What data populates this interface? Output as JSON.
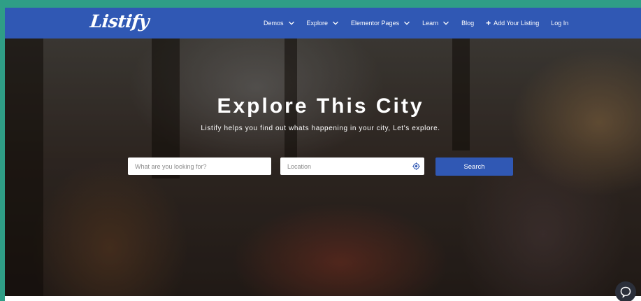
{
  "brand": {
    "logo_text": "Listify"
  },
  "nav": {
    "items": [
      {
        "label": "Demos",
        "has_dropdown": true
      },
      {
        "label": "Explore",
        "has_dropdown": true
      },
      {
        "label": "Elementor Pages",
        "has_dropdown": true
      },
      {
        "label": "Learn",
        "has_dropdown": true
      },
      {
        "label": "Blog",
        "has_dropdown": false
      },
      {
        "label": "Add Your Listing",
        "has_dropdown": false,
        "icon": "plus-icon"
      },
      {
        "label": "Log In",
        "has_dropdown": false
      }
    ]
  },
  "hero": {
    "title": "Explore This City",
    "subtitle": "Listify helps you find out whats happening in your city, Let's explore."
  },
  "search": {
    "keyword_placeholder": "What are you looking for?",
    "location_placeholder": "Location",
    "locate_icon": "crosshair-icon",
    "button_label": "Search"
  },
  "chat": {
    "icon": "chat-bubble-icon"
  },
  "colors": {
    "brand_blue": "#3058b4",
    "page_border": "#2f9e86",
    "text_on_blue": "#ffffff"
  }
}
